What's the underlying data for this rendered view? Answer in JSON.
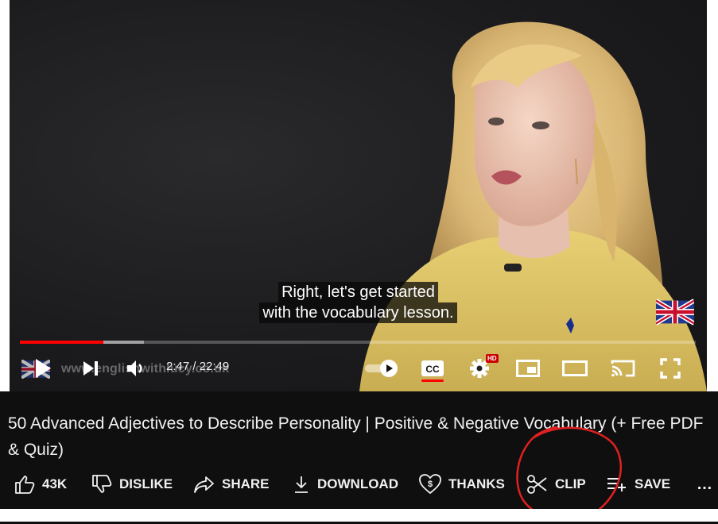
{
  "video": {
    "caption_line1": "Right, let's get started",
    "caption_line2": "with the vocabulary lesson.",
    "watermark": "www.englishwithlucy.co.uk",
    "time_display": "2:47 / 22:49",
    "progress_played": 0.123,
    "progress_buffered": 0.184,
    "hd_badge": "HD"
  },
  "title": "50 Advanced Adjectives to Describe Personality | Positive & Negative Vocabulary (+ Free PDF & Quiz)",
  "actions": {
    "like_count": "43K",
    "dislike": "DISLIKE",
    "share": "SHARE",
    "download": "DOWNLOAD",
    "thanks": "THANKS",
    "clip": "CLIP",
    "save": "SAVE",
    "more": "…"
  },
  "colors": {
    "progress": "#ff0000",
    "annotation": "#e02020",
    "background": "#0f0f0f"
  },
  "icons": [
    "play-icon",
    "next-icon",
    "volume-icon",
    "autoplay-toggle-icon",
    "cc-icon",
    "settings-icon",
    "miniplayer-icon",
    "theater-icon",
    "cast-icon",
    "fullscreen-icon",
    "like-icon",
    "dislike-icon",
    "share-icon",
    "download-icon",
    "thanks-icon",
    "scissors-icon",
    "save-playlist-icon",
    "more-icon"
  ]
}
